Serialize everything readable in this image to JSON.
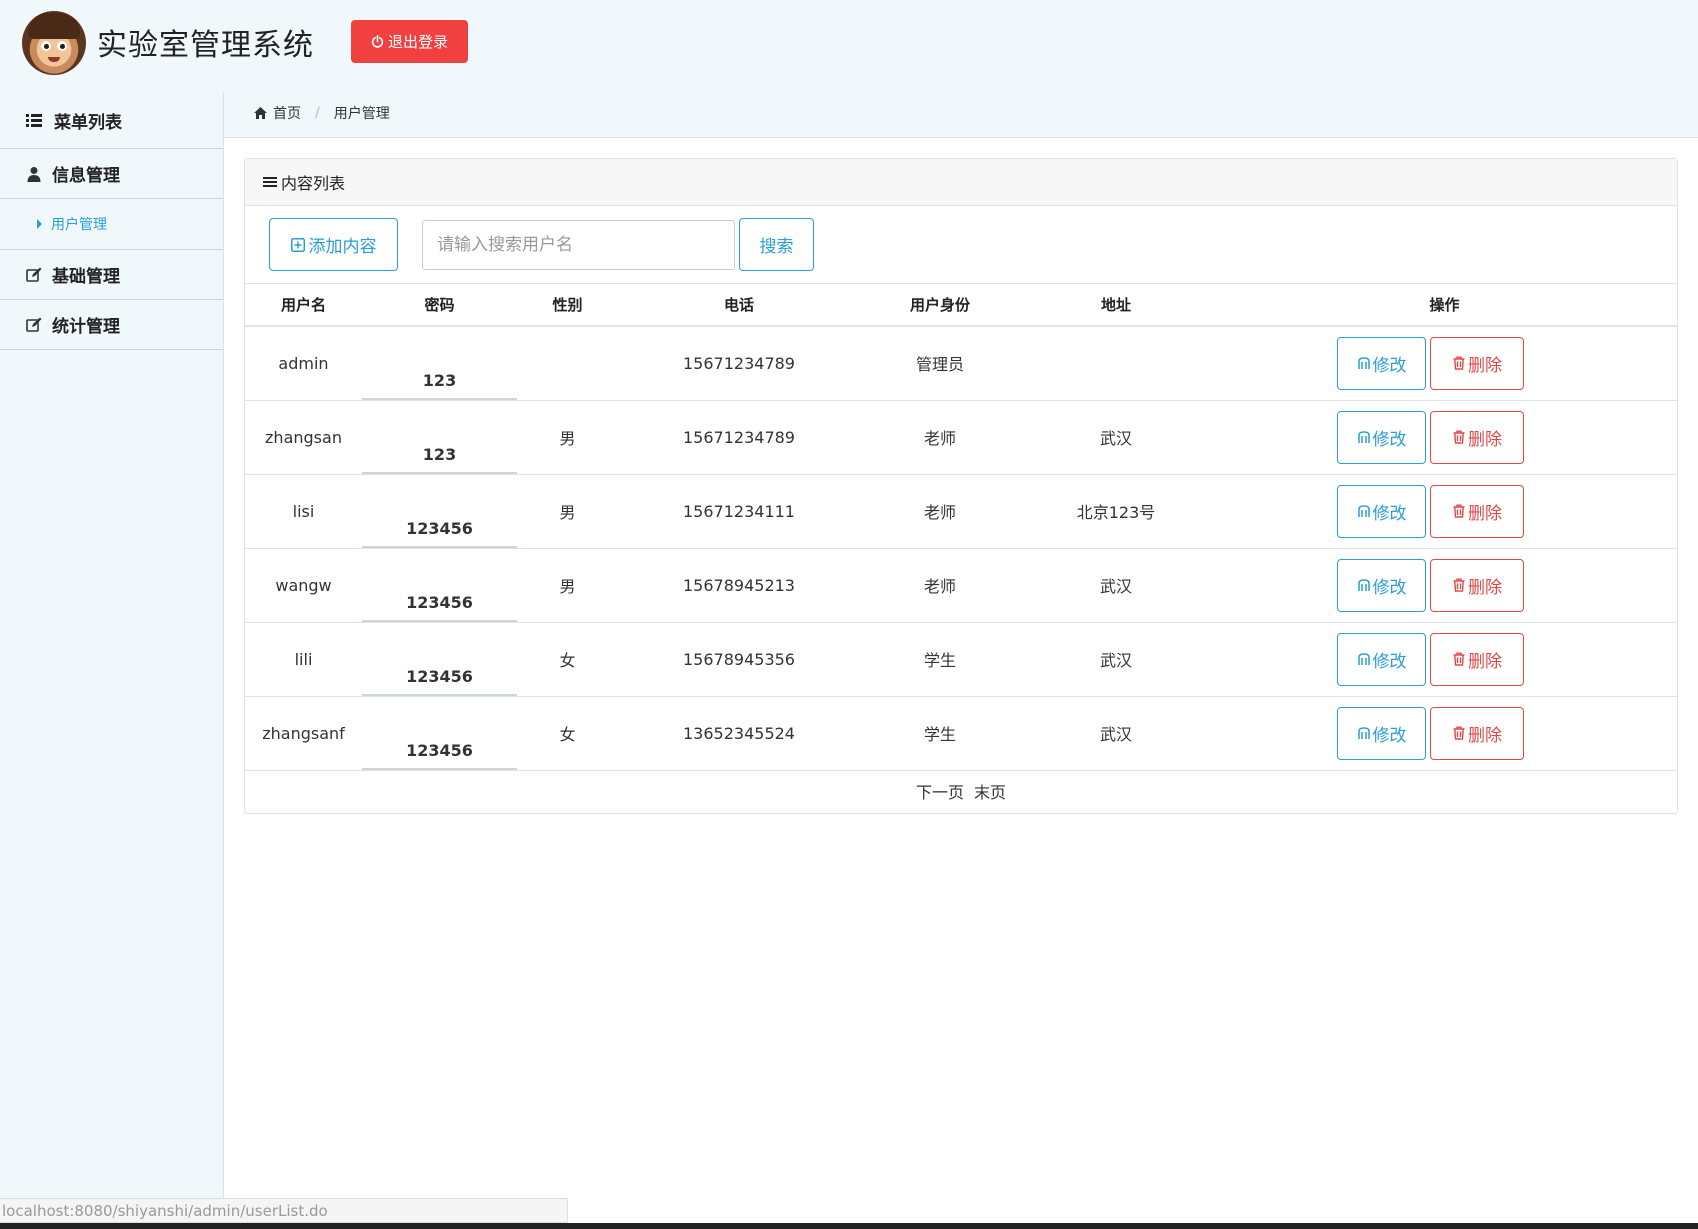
{
  "app": {
    "title": "实验室管理系统",
    "logout_label": "退出登录"
  },
  "sidebar": {
    "header": "菜单列表",
    "items": [
      {
        "label": "信息管理",
        "icon": "user-icon"
      },
      {
        "label": "用户管理",
        "icon": "caret-right-icon",
        "sub": true
      },
      {
        "label": "基础管理",
        "icon": "edit-icon"
      },
      {
        "label": "统计管理",
        "icon": "edit-icon"
      }
    ]
  },
  "breadcrumb": {
    "home": "首页",
    "current": "用户管理"
  },
  "panel": {
    "title": "内容列表"
  },
  "toolbar": {
    "add_label": "添加内容",
    "search_placeholder": "请输入搜索用户名",
    "search_label": "搜索"
  },
  "table": {
    "columns": [
      "用户名",
      "密码",
      "性别",
      "电话",
      "用户身份",
      "地址",
      "操作"
    ],
    "rows": [
      {
        "username": "admin",
        "password": "123",
        "gender": "",
        "phone": "15671234789",
        "role": "管理员",
        "address": ""
      },
      {
        "username": "zhangsan",
        "password": "123",
        "gender": "男",
        "phone": "15671234789",
        "role": "老师",
        "address": "武汉"
      },
      {
        "username": "lisi",
        "password": "123456",
        "gender": "男",
        "phone": "15671234111",
        "role": "老师",
        "address": "北京123号"
      },
      {
        "username": "wangw",
        "password": "123456",
        "gender": "男",
        "phone": "15678945213",
        "role": "老师",
        "address": "武汉"
      },
      {
        "username": "lili",
        "password": "123456",
        "gender": "女",
        "phone": "15678945356",
        "role": "学生",
        "address": "武汉"
      },
      {
        "username": "zhangsanf",
        "password": "123456",
        "gender": "女",
        "phone": "13652345524",
        "role": "学生",
        "address": "武汉"
      }
    ],
    "edit_label": "修改",
    "delete_label": "删除"
  },
  "pager": {
    "next": "下一页",
    "last": "末页"
  },
  "statusbar": {
    "url": "localhost:8080/shiyanshi/admin/userList.do"
  },
  "colors": {
    "accent": "#2a9fd6",
    "danger": "#e04848",
    "logout": "#f04040",
    "background": "#f1f8fb"
  }
}
